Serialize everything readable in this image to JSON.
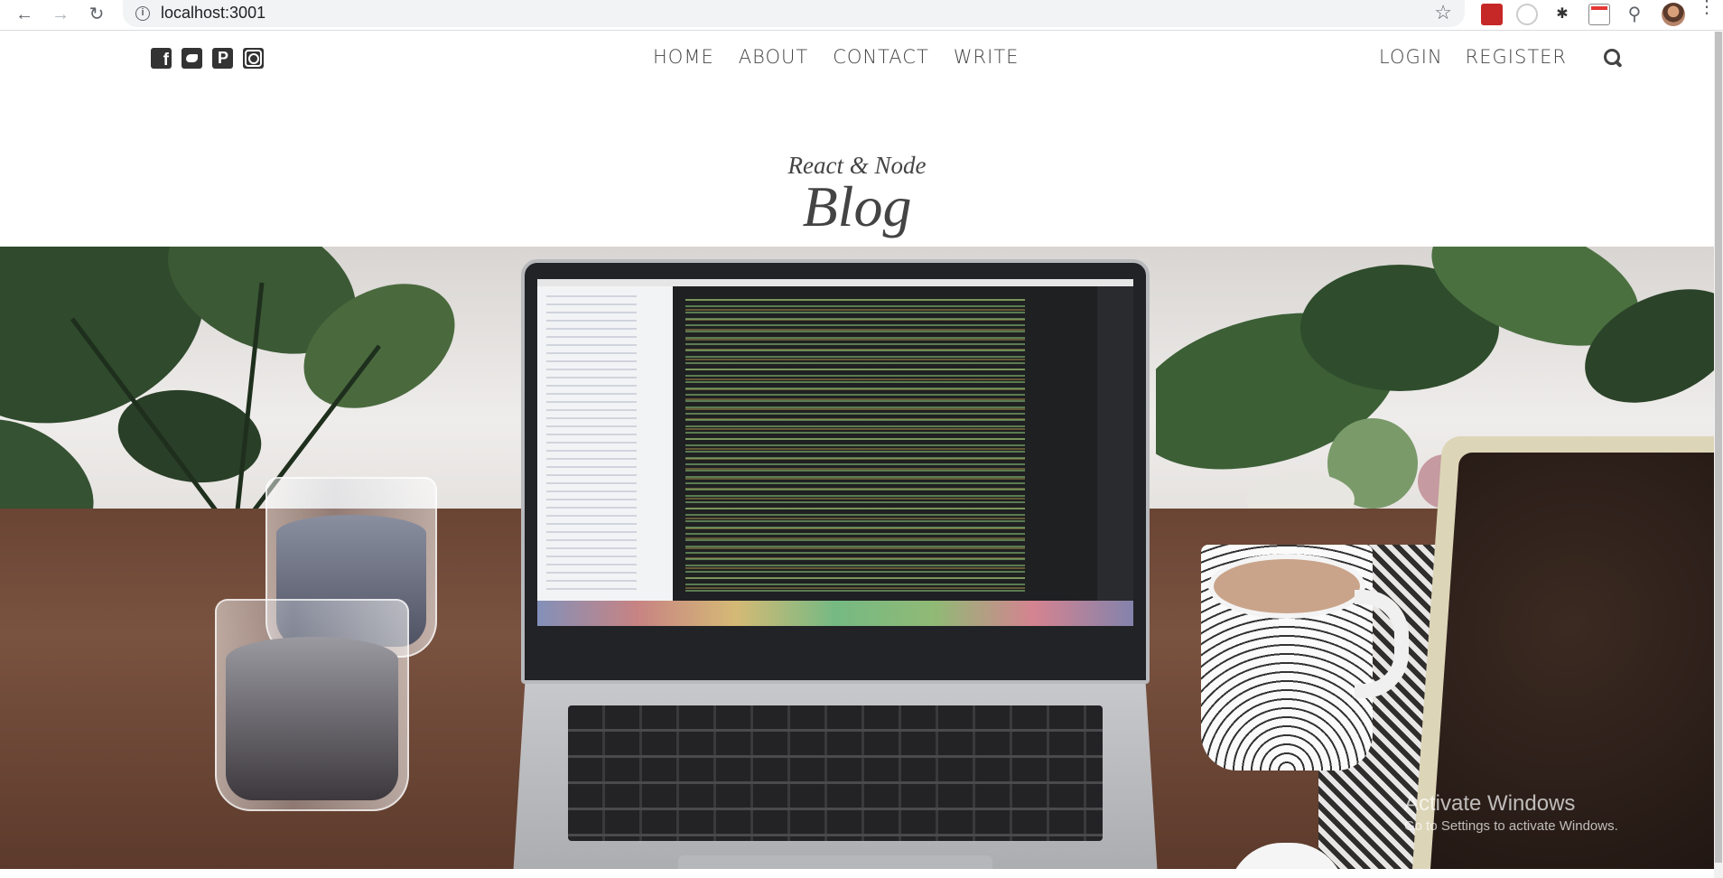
{
  "browser": {
    "url": "localhost:3001",
    "back_icon": "back-arrow-icon",
    "forward_icon": "forward-arrow-icon",
    "reload_icon": "reload-icon"
  },
  "social_icons": [
    "facebook-square-icon",
    "twitter-square-icon",
    "pinterest-square-icon",
    "instagram-square-icon"
  ],
  "nav": {
    "menu": [
      "HOME",
      "ABOUT",
      "CONTACT",
      "WRITE"
    ],
    "auth": [
      "LOGIN",
      "REGISTER"
    ],
    "search_icon": "search-icon"
  },
  "header": {
    "title_small": "React & Node",
    "title_large": "Blog"
  },
  "watermark": {
    "title": "Activate Windows",
    "subtitle": "Go to Settings to activate Windows."
  },
  "colors": {
    "text": "#444444",
    "background": "#ffffff"
  }
}
